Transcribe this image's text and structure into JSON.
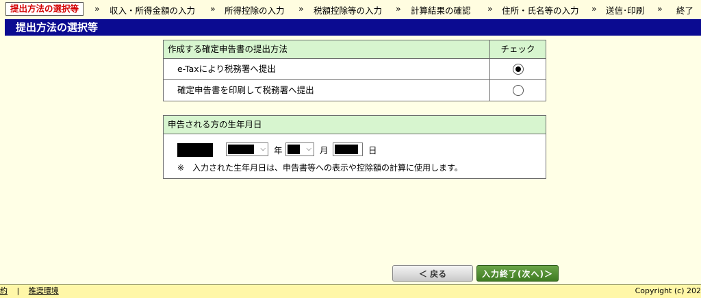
{
  "steps": [
    {
      "label": "提出方法の選択等"
    },
    {
      "label": "収入・所得金額の入力"
    },
    {
      "label": "所得控除の入力"
    },
    {
      "label": "税額控除等の入力"
    },
    {
      "label": "計算結果の確認"
    },
    {
      "label": "住所・氏名等の入力"
    },
    {
      "label": "送信･印刷"
    },
    {
      "label": "終了"
    }
  ],
  "separator": "»",
  "page_title": "提出方法の選択等",
  "submit_method": {
    "header": "作成する確定申告書の提出方法",
    "check_header": "チェック",
    "options": [
      {
        "label": "e-Taxにより税務署へ提出",
        "selected": true
      },
      {
        "label": "確定申告書を印刷して税務署へ提出",
        "selected": false
      }
    ]
  },
  "dob": {
    "header": "申告される方の生年月日",
    "year_unit": "年",
    "month_unit": "月",
    "day_unit": "日",
    "note": "※　入力された生年月日は、申告書等への表示や控除額の計算に使用します。"
  },
  "buttons": {
    "back": "＜ 戻る",
    "next": "入力終了(次へ)＞"
  },
  "footer": {
    "left1": "約",
    "sep": "|",
    "left2": "推奨環境",
    "copyright": "Copyright (c) 202"
  }
}
